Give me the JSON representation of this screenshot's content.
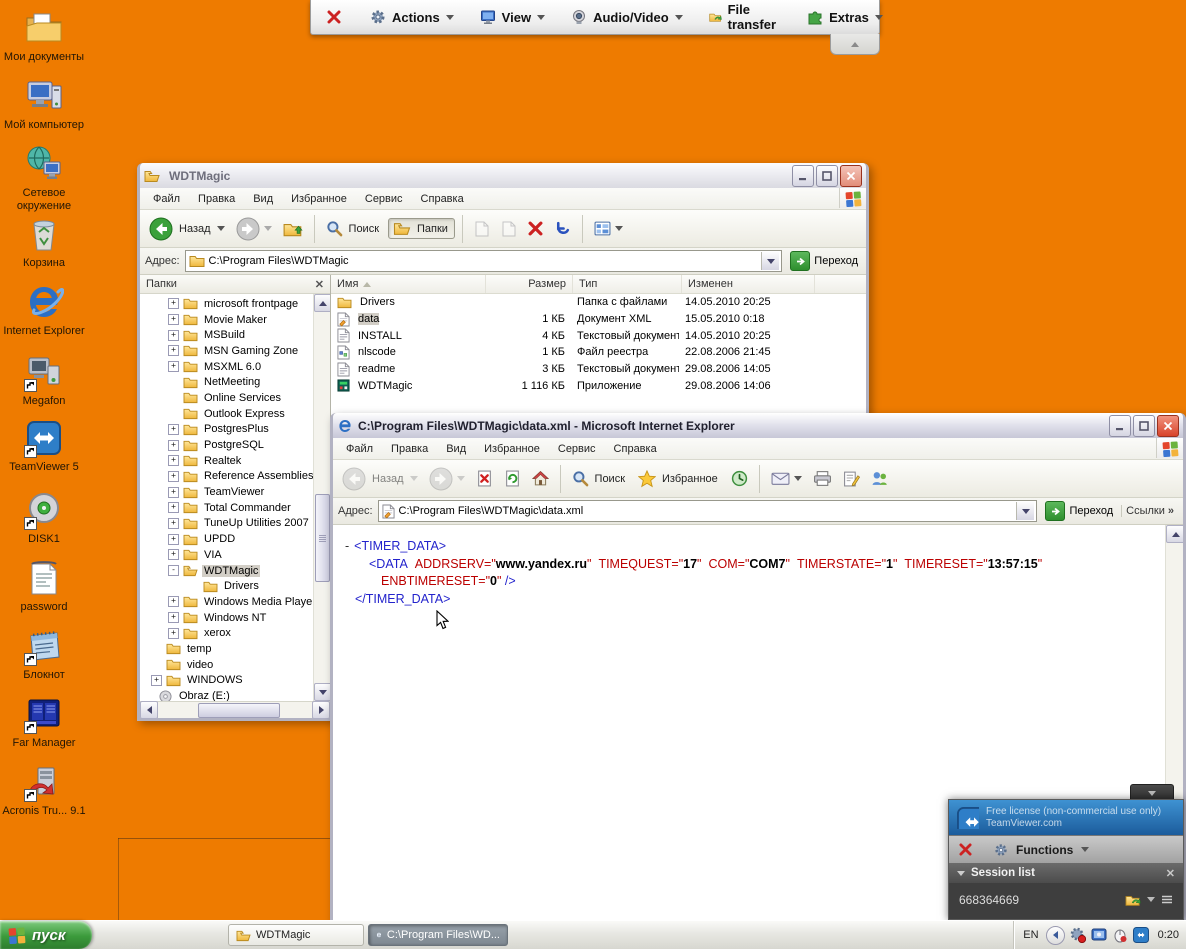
{
  "colors": {
    "desktop_bg": "#EE7B00",
    "selection_gray": "#D2CEC6",
    "xml_tag_blue": "#2323CC",
    "xml_attr_red": "#BB0000",
    "start_green": "#3B9A3B",
    "tv_header_blue": "#1C5C9C"
  },
  "desktop": {
    "icons": [
      {
        "label": "Мои документы"
      },
      {
        "label": "Мой компьютер"
      },
      {
        "label": "Сетевое окружение"
      },
      {
        "label": "Корзина"
      },
      {
        "label": "Internet Explorer"
      },
      {
        "label": "Megafon"
      },
      {
        "label": "TeamViewer 5"
      },
      {
        "label": "DISK1"
      },
      {
        "label": "password"
      },
      {
        "label": "Блокнот"
      },
      {
        "label": "Far Manager"
      },
      {
        "label": "Acronis Tru... 9.1"
      }
    ]
  },
  "tv_toolbar": {
    "actions": "Actions",
    "view": "View",
    "audio": "Audio/Video",
    "file_transfer": "File transfer",
    "extras": "Extras"
  },
  "explorer": {
    "title": "WDTMagic",
    "menu": [
      "Файл",
      "Правка",
      "Вид",
      "Избранное",
      "Сервис",
      "Справка"
    ],
    "toolbar": {
      "back": "Назад",
      "search": "Поиск",
      "folders": "Папки"
    },
    "address_label": "Адрес:",
    "address": "C:\\Program Files\\WDTMagic",
    "go": "Переход",
    "folders_header": "Папки",
    "columns": [
      "Имя",
      "Размер",
      "Тип",
      "Изменен"
    ],
    "files": [
      {
        "name": "Drivers",
        "size": "",
        "type": "Папка с файлами",
        "modified": "14.05.2010 20:25"
      },
      {
        "name": "data",
        "size": "1 КБ",
        "type": "Документ XML",
        "modified": "15.05.2010 0:18"
      },
      {
        "name": "INSTALL",
        "size": "4 КБ",
        "type": "Текстовый документ",
        "modified": "14.05.2010 20:25"
      },
      {
        "name": "nlscode",
        "size": "1 КБ",
        "type": "Файл реестра",
        "modified": "22.08.2006 21:45"
      },
      {
        "name": "readme",
        "size": "3 КБ",
        "type": "Текстовый документ",
        "modified": "29.08.2006 14:05"
      },
      {
        "name": "WDTMagic",
        "size": "1 116 КБ",
        "type": "Приложение",
        "modified": "29.08.2006 14:06"
      }
    ],
    "tree": [
      {
        "label": "microsoft frontpage",
        "exp": "+"
      },
      {
        "label": "Movie Maker",
        "exp": "+"
      },
      {
        "label": "MSBuild",
        "exp": "+"
      },
      {
        "label": "MSN Gaming Zone",
        "exp": "+"
      },
      {
        "label": "MSXML 6.0",
        "exp": "+"
      },
      {
        "label": "NetMeeting",
        "exp": ""
      },
      {
        "label": "Online Services",
        "exp": ""
      },
      {
        "label": "Outlook Express",
        "exp": ""
      },
      {
        "label": "PostgresPlus",
        "exp": "+"
      },
      {
        "label": "PostgreSQL",
        "exp": "+"
      },
      {
        "label": "Realtek",
        "exp": "+"
      },
      {
        "label": "Reference Assemblies",
        "exp": "+"
      },
      {
        "label": "TeamViewer",
        "exp": "+"
      },
      {
        "label": "Total Commander",
        "exp": "+"
      },
      {
        "label": "TuneUp Utilities 2007",
        "exp": "+"
      },
      {
        "label": "UPDD",
        "exp": "+"
      },
      {
        "label": "VIA",
        "exp": "+"
      },
      {
        "label": "WDTMagic",
        "exp": "-"
      },
      {
        "label": "Drivers",
        "exp": ""
      },
      {
        "label": "Windows Media Player",
        "exp": "+"
      },
      {
        "label": "Windows NT",
        "exp": "+"
      },
      {
        "label": "xerox",
        "exp": "+"
      },
      {
        "label": "temp",
        "exp": ""
      },
      {
        "label": "video",
        "exp": ""
      },
      {
        "label": "WINDOWS",
        "exp": "+"
      },
      {
        "label": "Obraz (E:)",
        "exp": ""
      }
    ]
  },
  "ie": {
    "title": "C:\\Program Files\\WDTMagic\\data.xml - Microsoft Internet Explorer",
    "menu": [
      "Файл",
      "Правка",
      "Вид",
      "Избранное",
      "Сервис",
      "Справка"
    ],
    "toolbar": {
      "back": "Назад",
      "search": "Поиск",
      "favorites": "Избранное"
    },
    "address_label": "Адрес:",
    "address": "C:\\Program Files\\WDTMagic\\data.xml",
    "go": "Переход",
    "links": "Ссылки",
    "xml": {
      "marker": "-",
      "root_open": "<TIMER_DATA>",
      "data_open": "<DATA",
      "attrs": [
        {
          "name": "ADDRSERV",
          "value": "www.yandex.ru"
        },
        {
          "name": "TIMEQUEST",
          "value": "17"
        },
        {
          "name": "COM",
          "value": "COM7"
        },
        {
          "name": "TIMERSTATE",
          "value": "1"
        },
        {
          "name": "TIMERESET",
          "value": "13:57:15"
        },
        {
          "name": "ENBTIMERESET",
          "value": "0"
        }
      ],
      "self_close": "/>",
      "root_close": "</TIMER_DATA>"
    }
  },
  "tv_panel": {
    "license_line1": "Free license (non-commercial use only)",
    "license_line2": "TeamViewer.com",
    "functions": "Functions",
    "session_list": "Session list",
    "session_id": "668364669"
  },
  "taskbar": {
    "start": "пуск",
    "buttons": [
      {
        "label": "WDTMagic"
      },
      {
        "label": "C:\\Program Files\\WD..."
      }
    ],
    "tray": {
      "lang": "EN",
      "time": "0:20"
    }
  }
}
